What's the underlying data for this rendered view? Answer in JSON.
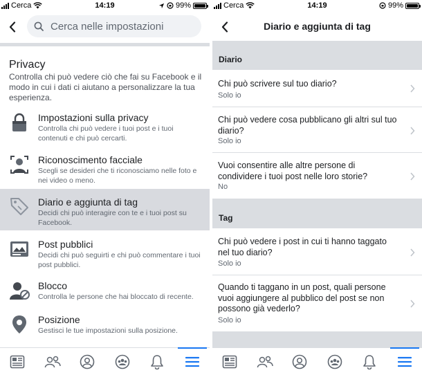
{
  "status_left": {
    "carrier": "Cerca",
    "time": "14:19",
    "battery": "99%",
    "battery_level": 0.99
  },
  "status_right": {
    "carrier": "Cerca",
    "time": "14:19",
    "battery": "99%",
    "battery_level": 0.99
  },
  "search": {
    "placeholder": "Cerca nelle impostazioni"
  },
  "privacy": {
    "title": "Privacy",
    "description": "Controlla chi può vedere ciò che fai su Facebook e il modo in cui i dati ci aiutano a personalizzare la tua esperienza.",
    "items": [
      {
        "title": "Impostazioni sulla privacy",
        "desc": "Controlla chi può vedere i tuoi post e i tuoi contenuti e chi può cercarti.",
        "icon": "lock-icon"
      },
      {
        "title": "Riconoscimento facciale",
        "desc": "Scegli se desideri che ti riconosciamo nelle foto e nei video o meno.",
        "icon": "face-recognition-icon"
      },
      {
        "title": "Diario e aggiunta di tag",
        "desc": "Decidi chi può interagire con te e i tuoi post su Facebook.",
        "icon": "tag-icon",
        "selected": true
      },
      {
        "title": "Post pubblici",
        "desc": "Decidi chi può seguirti e chi può commentare i tuoi post pubblici.",
        "icon": "public-posts-icon"
      },
      {
        "title": "Blocco",
        "desc": "Controlla le persone che hai bloccato di recente.",
        "icon": "block-user-icon"
      },
      {
        "title": "Posizione",
        "desc": "Gestisci le tue impostazioni sulla posizione.",
        "icon": "location-pin-icon"
      }
    ]
  },
  "tabbar": [
    "news-feed-icon",
    "friends-icon",
    "profile-icon",
    "groups-icon",
    "notifications-bell-icon",
    "menu-icon"
  ],
  "timeline": {
    "title": "Diario e aggiunta di tag",
    "sections": [
      {
        "header": "Diario",
        "rows": [
          {
            "title": "Chi può scrivere sul tuo diario?",
            "value": "Solo io"
          },
          {
            "title": "Chi può vedere cosa pubblicano gli altri sul tuo diario?",
            "value": "Solo io"
          },
          {
            "title": "Vuoi consentire alle altre persone di condividere i tuoi post nelle loro storie?",
            "value": "No"
          }
        ]
      },
      {
        "header": "Tag",
        "rows": [
          {
            "title": "Chi può vedere i post in cui ti hanno taggato nel tuo diario?",
            "value": "Solo io"
          },
          {
            "title": "Quando ti taggano in un post, quali persone vuoi aggiungere al pubblico del post se non possono già vederlo?",
            "value": "Solo io"
          }
        ]
      }
    ]
  }
}
